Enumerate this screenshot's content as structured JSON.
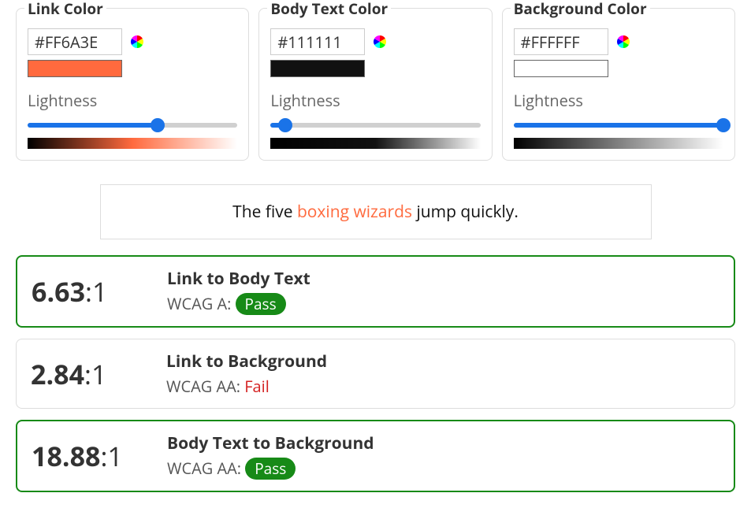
{
  "cards": {
    "link": {
      "title": "Link Color",
      "hex": "#FF6A3E",
      "lightness_label": "Lightness",
      "slider_pct": 62,
      "swatch": "#FF6A3E",
      "grad_mid": "#FF6A3E"
    },
    "body": {
      "title": "Body Text Color",
      "hex": "#111111",
      "lightness_label": "Lightness",
      "slider_pct": 7,
      "swatch": "#111111",
      "grad_mid": "#111111"
    },
    "bg": {
      "title": "Background Color",
      "hex": "#FFFFFF",
      "lightness_label": "Lightness",
      "slider_pct": 100,
      "swatch": "#FFFFFF",
      "grad_mid": "#808080"
    }
  },
  "preview": {
    "before": "The five ",
    "link": "boxing wizards",
    "after": " jump quickly."
  },
  "results": [
    {
      "ratio": "6.63",
      "suffix": ":1",
      "title": "Link to Body Text",
      "label": "WCAG A: ",
      "status": "Pass",
      "pass": true
    },
    {
      "ratio": "2.84",
      "suffix": ":1",
      "title": "Link to Background",
      "label": "WCAG AA: ",
      "status": "Fail",
      "pass": false
    },
    {
      "ratio": "18.88",
      "suffix": ":1",
      "title": "Body Text to Background",
      "label": "WCAG AA: ",
      "status": "Pass",
      "pass": true
    }
  ]
}
